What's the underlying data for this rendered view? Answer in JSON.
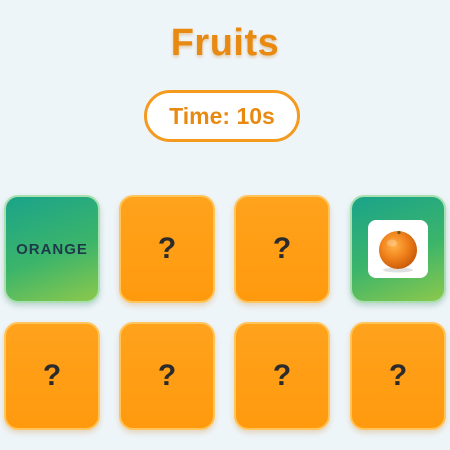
{
  "header": {
    "title": "Fruits"
  },
  "timer": {
    "label": "Time: 10s"
  },
  "cards": [
    {
      "state": "revealed",
      "content": "ORANGE"
    },
    {
      "state": "hidden",
      "content": "?"
    },
    {
      "state": "hidden",
      "content": "?"
    },
    {
      "state": "revealed",
      "content": "orange-image"
    },
    {
      "state": "hidden",
      "content": "?"
    },
    {
      "state": "hidden",
      "content": "?"
    },
    {
      "state": "hidden",
      "content": "?"
    },
    {
      "state": "hidden",
      "content": "?"
    }
  ],
  "colors": {
    "accent": "#f39a1f",
    "card_back": "#ff9e16",
    "card_front_start": "#1aa38a",
    "card_front_end": "#8cc84c",
    "background": "#eef5f9"
  }
}
